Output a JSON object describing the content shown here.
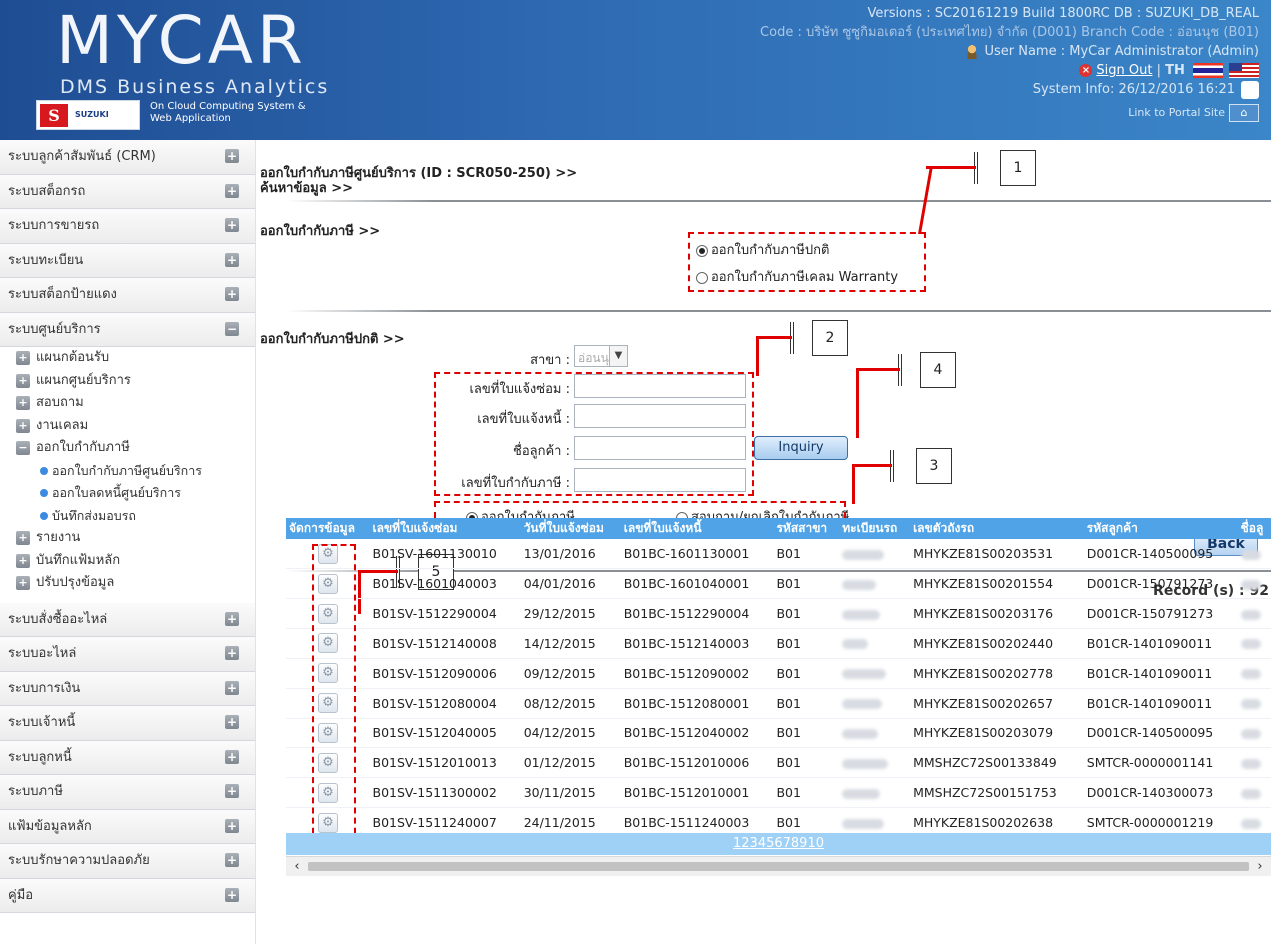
{
  "header": {
    "logo_title": "MYCAR",
    "logo_subtitle": "DMS Business Analytics",
    "brand_logo_text": "SUZUKI",
    "cloud_text": "On Cloud Computing System & Web Application",
    "version_line": "Versions : SC20161219 Build 1800RC DB : SUZUKI_DB_REAL",
    "company_line": "Code : บริษัท ซูซูกิมอเตอร์ (ประเทศไทย) จำกัด (D001)  Branch Code : อ่อนนุช (B01)",
    "user_line": "User Name : MyCar Administrator  (Admin)",
    "sign_out": "Sign Out",
    "lang": "TH",
    "system_info": "System Info: 26/12/2016 16:21",
    "portal_link": "Link to Portal Site"
  },
  "sidebar": {
    "items_top": [
      "ระบบลูกค้าสัมพันธ์ (CRM)",
      "ระบบสต็อกรถ",
      "ระบบการขายรถ",
      "ระบบทะเบียน",
      "ระบบสต็อกป้ายแดง",
      "ระบบศูนย์บริการ"
    ],
    "sub_items": [
      "แผนกต้อนรับ",
      "แผนกศูนย์บริการ",
      "สอบถาม",
      "งานเคลม",
      "ออกใบกำกับภาษี"
    ],
    "subsub_items": [
      "ออกใบกำกับภาษีศูนย์บริการ",
      "ออกใบลดหนี้ศูนย์บริการ",
      "บันทึกส่งมอบรถ"
    ],
    "sub_items_after": [
      "รายงาน",
      "บันทึกแฟ้มหลัก",
      "ปรับปรุงข้อมูล"
    ],
    "items_bottom": [
      "ระบบสั่งซื้ออะไหล่",
      "ระบบอะไหล่",
      "ระบบการเงิน",
      "ระบบเจ้าหนี้",
      "ระบบลูกหนี้",
      "ระบบภาษี",
      "แฟ้มข้อมูลหลัก",
      "ระบบรักษาความปลอดภัย",
      "คู่มือ"
    ]
  },
  "main": {
    "title": "ออกใบกำกับภาษีศูนย์บริการ (ID : SCR050-250) >>",
    "subtitle": "ค้นหาข้อมูล >>",
    "section1_title": "ออกใบกำกับภาษี >>",
    "radio_normal": "ออกใบกำกับภาษีปกติ",
    "radio_warranty": "ออกใบกำกับภาษีเคลม Warranty",
    "section2_title": "ออกใบกำกับภาษีปกติ >>",
    "branch_label": "สาขา :",
    "branch_value": "อ่อนนุช",
    "repair_no_label": "เลขที่ใบแจ้งซ่อม :",
    "debt_no_label": "เลขที่ใบแจ้งหนี้ :",
    "customer_label": "ชื่อลูกค้า :",
    "tax_no_label": "เลขที่ใบกำกับภาษี :",
    "inquiry": "Inquiry",
    "radio_issue": "ออกใบกำกับภาษี",
    "radio_cancel": "สอบถาม/ยกเลิกใบกำกับภาษี",
    "back": "Back",
    "record_count": "Record (s) : 92",
    "callouts": [
      "1",
      "2",
      "3",
      "4",
      "5"
    ],
    "pager": "12345678910"
  },
  "table": {
    "headers": [
      "จัดการข้อมูล",
      "เลขที่ใบแจ้งซ่อม",
      "วันที่ใบแจ้งซ่อม",
      "เลขที่ใบแจ้งหนี้",
      "รหัสสาขา",
      "ทะเบียนรถ",
      "เลขตัวถังรถ",
      "รหัสลูกค้า",
      "ชื่อลู"
    ],
    "rows": [
      [
        "B01SV-1601130010",
        "13/01/2016",
        "B01BC-1601130001",
        "B01",
        "MHYKZE81S00203531",
        "D001CR-140500095"
      ],
      [
        "B01SV-1601040003",
        "04/01/2016",
        "B01BC-1601040001",
        "B01",
        "MHYKZE81S00201554",
        "D001CR-150791273"
      ],
      [
        "B01SV-1512290004",
        "29/12/2015",
        "B01BC-1512290004",
        "B01",
        "MHYKZE81S00203176",
        "D001CR-150791273"
      ],
      [
        "B01SV-1512140008",
        "14/12/2015",
        "B01BC-1512140003",
        "B01",
        "MHYKZE81S00202440",
        "B01CR-1401090011"
      ],
      [
        "B01SV-1512090006",
        "09/12/2015",
        "B01BC-1512090002",
        "B01",
        "MHYKZE81S00202778",
        "B01CR-1401090011"
      ],
      [
        "B01SV-1512080004",
        "08/12/2015",
        "B01BC-1512080001",
        "B01",
        "MHYKZE81S00202657",
        "B01CR-1401090011"
      ],
      [
        "B01SV-1512040005",
        "04/12/2015",
        "B01BC-1512040002",
        "B01",
        "MHYKZE81S00203079",
        "D001CR-140500095"
      ],
      [
        "B01SV-1512010013",
        "01/12/2015",
        "B01BC-1512010006",
        "B01",
        "MMSHZC72S00133849",
        "SMTCR-0000001141"
      ],
      [
        "B01SV-1511300002",
        "30/11/2015",
        "B01BC-1512010001",
        "B01",
        "MMSHZC72S00151753",
        "D001CR-140300073"
      ],
      [
        "B01SV-1511240007",
        "24/11/2015",
        "B01BC-1511240003",
        "B01",
        "MHYKZE81S00202638",
        "SMTCR-0000001219"
      ]
    ]
  },
  "colors": {
    "header_blue": "#2e6ab2",
    "table_header": "#4fa3e6",
    "annotation_red": "#e00000"
  }
}
